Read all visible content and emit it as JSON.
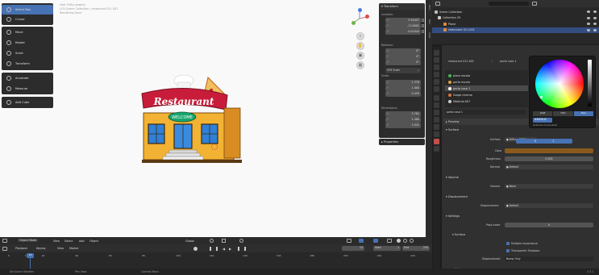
{
  "viewport": {
    "info": [
      "User Ortho graphic",
      "(13) Scene Collection | restaurant 011.001",
      "Rendering Done"
    ],
    "tools": [
      {
        "label": "Select Box",
        "active": true
      },
      {
        "label": "Cursor"
      },
      {
        "label": "Move"
      },
      {
        "label": "Rotate"
      },
      {
        "label": "Scale"
      },
      {
        "label": "Transform"
      },
      {
        "label": "Annotate"
      },
      {
        "label": "Measure"
      },
      {
        "label": "Add Cube"
      }
    ],
    "model": {
      "sign_text": "Restaurant",
      "welcome_text": "WELCOME"
    },
    "gizmo_axes": [
      "X",
      "Y",
      "Z"
    ]
  },
  "transform": {
    "title": "Transform",
    "location_label": "Location:",
    "location": [
      "5.94457",
      "-13.8002",
      "-0.01944"
    ],
    "rotation_label": "Rotation:",
    "rotation": [
      "0°",
      "0°",
      "0°"
    ],
    "rotation_mode": "XYZ Euler",
    "scale_label": "Scale:",
    "scale": [
      "1.576",
      "1.000",
      "0.429"
    ],
    "dimensions_label": "Dimensions:",
    "dimensions": [
      "3.762",
      "2.480",
      "3.042"
    ],
    "axis_names": [
      "X",
      "Y",
      "Z"
    ],
    "properties_label": "Properties"
  },
  "side_tabs": [
    "Item",
    "Tool",
    "View"
  ],
  "outliner": {
    "rows": [
      {
        "label": "Scene Collection",
        "indent": 3,
        "color": "#bbbbbb"
      },
      {
        "label": "Collection 29",
        "indent": 7,
        "color": "#cccccc"
      },
      {
        "label": "Plane",
        "indent": 14,
        "color": "#e08a3c"
      },
      {
        "label": "restaurant 011.001",
        "indent": 14,
        "color": "#e08a3c",
        "selected": true
      }
    ]
  },
  "properties": {
    "breadcrumb": "restaurant 011.001",
    "material_name": "porta casa 1",
    "slots": [
      "placa escola",
      "porta escola",
      "porta casa 1",
      "lixage cinema",
      "Material.007"
    ],
    "slot_colors": [
      "#3fb94b",
      "#e0a13c",
      "#ffffff",
      "#e06f3c",
      "#d0d0d0"
    ],
    "material_field": "porta casa 1",
    "preview": "Preview",
    "surface_section": "Surface",
    "surface_label": "Surface",
    "surface_value": "Diffuse BSDF",
    "color_label": "Color",
    "color_value": "#8a5a1c",
    "roughness_label": "Roughness",
    "roughness_value": "0.000",
    "normal_label": "Normal",
    "normal_value": "Default",
    "volume_section": "Volume",
    "volume_label": "Volume",
    "volume_value": "None",
    "displacement_section": "Displacement",
    "displacement_label": "Displacement",
    "displacement_value": "Default",
    "settings_section": "Settings",
    "pass_index_label": "Pass Index",
    "pass_index_value": "0",
    "surface_sub": "Surface",
    "multiple_importance": "Multiple Importance",
    "transparent_shadows": "Transparent Shadows",
    "disp_method_label": "Displacement",
    "disp_method_value": "Bump Only",
    "volume_sub": "Volume"
  },
  "color_picker": {
    "tabs": [
      "RGB",
      "HSV",
      "Hex"
    ],
    "hex": "#8A5A1C",
    "gamma": "(Gamma Corrected)",
    "v_label": "V",
    "v_value": "1"
  },
  "header3d": {
    "mode": "Object Mode",
    "menus": [
      "View",
      "Select",
      "Add",
      "Object"
    ],
    "orientation": "Global"
  },
  "timeline": {
    "menus": [
      "Playback",
      "Keying",
      "View",
      "Marker"
    ],
    "current_frame": "13",
    "start_label": "Start",
    "start": "1",
    "end_label": "End",
    "end": "250",
    "ticks": [
      "0",
      "10",
      "20",
      "40",
      "60",
      "80",
      "100",
      "120",
      "140",
      "160",
      "180",
      "200",
      "220",
      "240"
    ]
  },
  "status": {
    "items": [
      "Set Active Modifier",
      "Pan View",
      "Context Menu"
    ],
    "version": "3.3.1"
  }
}
